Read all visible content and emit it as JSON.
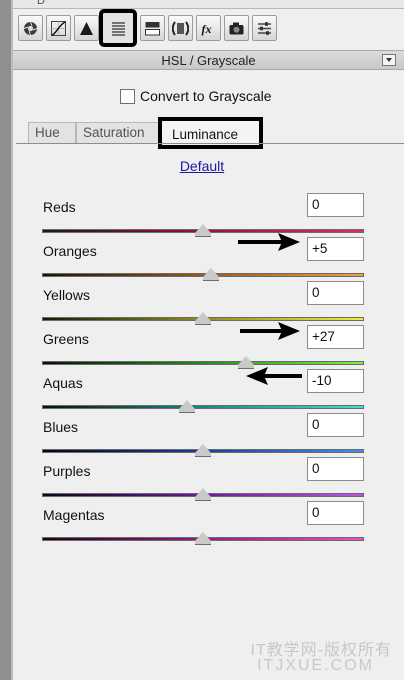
{
  "window": {
    "top_fragment": "D"
  },
  "toolbar": {
    "tools": [
      {
        "icon": "aperture-icon"
      },
      {
        "icon": "tone-curve-icon"
      },
      {
        "icon": "detail-triangle-icon"
      },
      {
        "icon": "hsl-grayscale-icon",
        "selected": true
      },
      {
        "icon": "split-toning-icon"
      },
      {
        "icon": "lens-corrections-icon"
      },
      {
        "icon": "effects-fx-icon"
      },
      {
        "icon": "camera-calibration-icon"
      },
      {
        "icon": "presets-icon"
      }
    ]
  },
  "panel": {
    "title": "HSL / Grayscale",
    "menu_icon": "panel-menu-icon"
  },
  "convert": {
    "label": "Convert to Grayscale",
    "checked": false
  },
  "tabs": {
    "hue": "Hue",
    "saturation": "Saturation",
    "luminance": "Luminance",
    "active": "Luminance"
  },
  "default_link": "Default",
  "sliders": [
    {
      "label": "Reds",
      "value": "0",
      "num": 0,
      "gradient": [
        "#1a1a1a",
        "#9a0f38",
        "#e32a66"
      ]
    },
    {
      "label": "Oranges",
      "value": "+5",
      "num": 5,
      "gradient": [
        "#1b130a",
        "#9a5a1a",
        "#f0a040"
      ]
    },
    {
      "label": "Yellows",
      "value": "0",
      "num": 0,
      "gradient": [
        "#181806",
        "#8f8f1a",
        "#f3ef3c"
      ]
    },
    {
      "label": "Greens",
      "value": "+27",
      "num": 27,
      "gradient": [
        "#061206",
        "#1f8f1a",
        "#7ef040"
      ]
    },
    {
      "label": "Aquas",
      "value": "-10",
      "num": -10,
      "gradient": [
        "#061212",
        "#1a8a7f",
        "#3ee0d8"
      ]
    },
    {
      "label": "Blues",
      "value": "0",
      "num": 0,
      "gradient": [
        "#06061a",
        "#1a3f9a",
        "#3f90f0"
      ]
    },
    {
      "label": "Purples",
      "value": "0",
      "num": 0,
      "gradient": [
        "#0f061a",
        "#6a1a9a",
        "#c050f0"
      ]
    },
    {
      "label": "Magentas",
      "value": "0",
      "num": 0,
      "gradient": [
        "#1a0616",
        "#9a1a7f",
        "#f04ac8"
      ]
    }
  ],
  "slider_range": [
    -100,
    100
  ],
  "watermark": {
    "cn": "IT教学网-版权所有",
    "url": "ITJXUE.COM"
  }
}
